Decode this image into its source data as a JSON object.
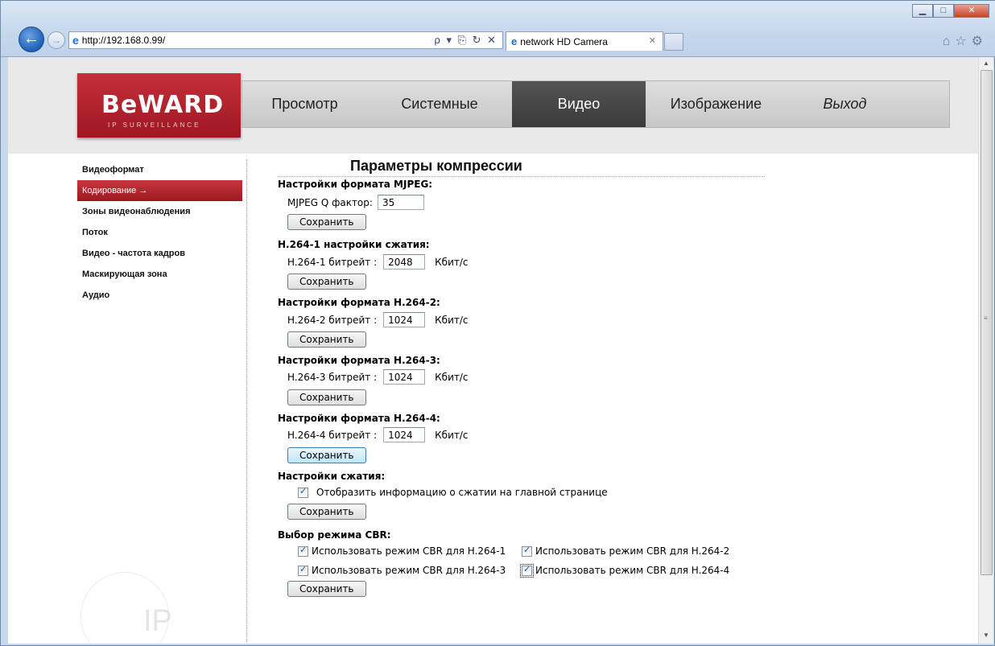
{
  "browser": {
    "url": "http://192.168.0.99/",
    "address_tools": "ρ ▾ ⎘ ↻ ✕",
    "tab_title": "network HD Camera"
  },
  "logo": {
    "brand": "BeWARD",
    "sub": "IP SURVEILLANCE"
  },
  "menu": [
    {
      "label": "Просмотр",
      "active": false
    },
    {
      "label": "Системные",
      "active": false
    },
    {
      "label": "Видео",
      "active": true
    },
    {
      "label": "Изображение",
      "active": false
    },
    {
      "label": "Выход",
      "active": false
    }
  ],
  "sidebar": [
    {
      "label": "Видеоформат"
    },
    {
      "label": "Кодирование →",
      "active": true
    },
    {
      "label": "Зоны видеонаблюдения"
    },
    {
      "label": "Поток"
    },
    {
      "label": "Видео - частота кадров"
    },
    {
      "label": "Маскирующая зона"
    },
    {
      "label": "Аудио"
    }
  ],
  "page": {
    "title": "Параметры компрессии",
    "save": "Сохранить",
    "unit": "Кбит/с",
    "mjpeg": {
      "header": "Настройки формата MJPEG:",
      "label": "MJPEG Q фактор:",
      "value": "35"
    },
    "h264_1": {
      "header": "H.264-1 настройки сжатия:",
      "label": "H.264-1 битрейт :",
      "value": "2048"
    },
    "h264_2": {
      "header": "Настройки формата H.264-2:",
      "label": "H.264-2 битрейт :",
      "value": "1024"
    },
    "h264_3": {
      "header": "Настройки формата H.264-3:",
      "label": "H.264-3 битрейт :",
      "value": "1024"
    },
    "h264_4": {
      "header": "Настройки формата H.264-4:",
      "label": "H.264-4 битрейт :",
      "value": "1024"
    },
    "compression": {
      "header": "Настройки сжатия:",
      "checkbox": "Отобразить информацию о сжатии на главной странице"
    },
    "cbr": {
      "header": "Выбор режима CBR:",
      "options": [
        "Использовать режим CBR для H.264-1",
        "Использовать режим CBR для H.264-2",
        "Использовать режим CBR для H.264-3",
        "Использовать режим CBR для H.264-4"
      ]
    }
  },
  "watermark": "IP"
}
